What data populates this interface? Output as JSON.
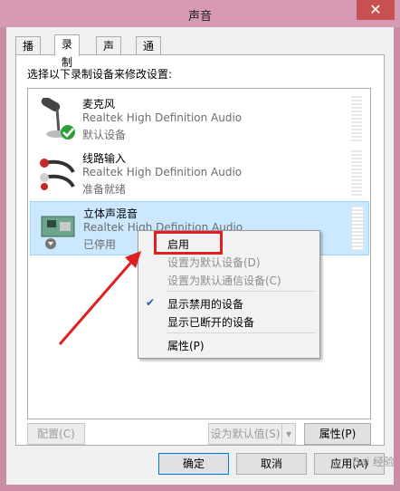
{
  "window": {
    "title": "声音",
    "close_icon": "close-icon"
  },
  "tabs": [
    {
      "label": "播放"
    },
    {
      "label": "录制"
    },
    {
      "label": "声音"
    },
    {
      "label": "通信"
    }
  ],
  "instruction": "选择以下录制设备来修改设置:",
  "devices": [
    {
      "name": "麦克风",
      "driver": "Realtek High Definition Audio",
      "status": "默认设备",
      "icon": "microphone-icon",
      "badge": "default-check-icon"
    },
    {
      "name": "线路输入",
      "driver": "Realtek High Definition Audio",
      "status": "准备就绪",
      "icon": "line-in-cable-icon"
    },
    {
      "name": "立体声混音",
      "driver": "Realtek High Definition Audio",
      "status": "已停用",
      "icon": "sound-card-icon",
      "badge": "disabled-arrow-icon"
    }
  ],
  "context_menu": {
    "items": [
      {
        "label": "启用"
      },
      {
        "label": "设置为默认设备(D)"
      },
      {
        "label": "设置为默认通信设备(C)"
      },
      {
        "label": "显示禁用的设备"
      },
      {
        "label": "显示已断开的设备"
      },
      {
        "label": "属性(P)"
      }
    ]
  },
  "buttons": {
    "configure": "配置(C)",
    "set_default": "设为默认值(S)",
    "properties": "属性(P)",
    "ok": "确定",
    "cancel": "取消",
    "apply": "应用(A)"
  },
  "watermark": "Bai 经验",
  "colors": {
    "selection": "#cce8ff",
    "highlight_box": "#e02020",
    "arrow": "#e02020",
    "title_bar": "#d79ab4"
  }
}
